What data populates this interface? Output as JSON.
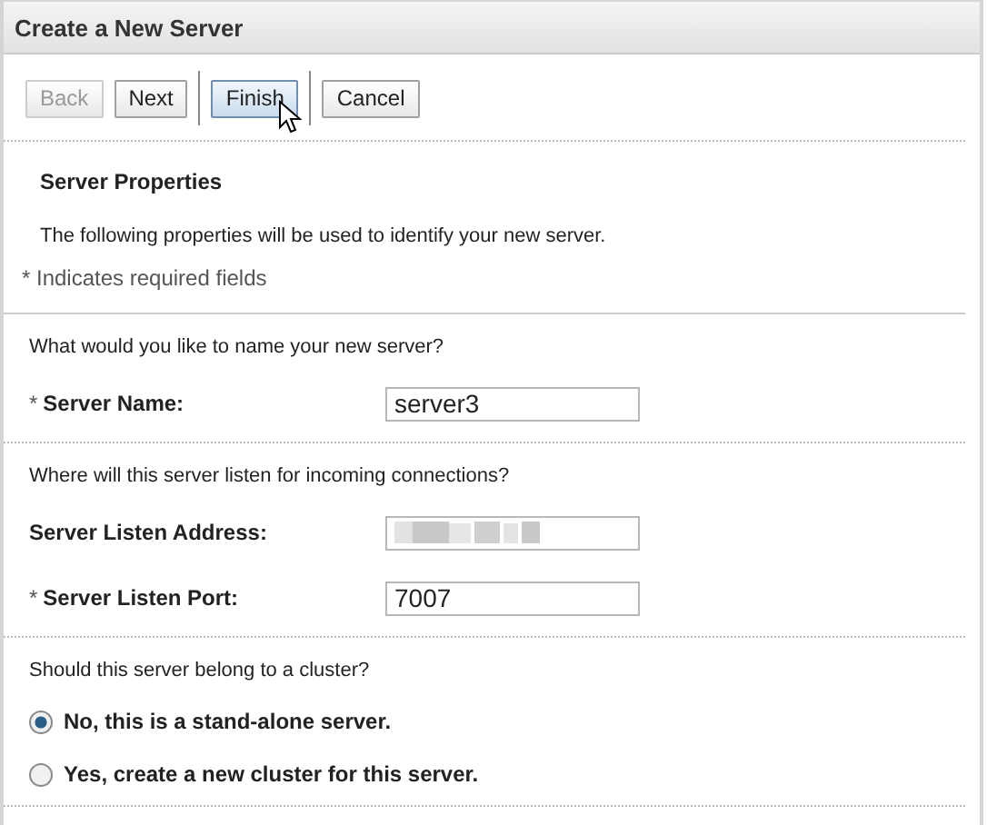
{
  "window": {
    "title": "Create a New Server"
  },
  "toolbar": [
    {
      "kind": "button",
      "label": "Back",
      "disabled": true,
      "hovered": false
    },
    {
      "kind": "button",
      "label": "Next",
      "disabled": false,
      "hovered": false
    },
    {
      "kind": "separator"
    },
    {
      "kind": "button",
      "label": "Finish",
      "disabled": false,
      "hovered": true
    },
    {
      "kind": "separator"
    },
    {
      "kind": "button",
      "label": "Cancel",
      "disabled": false,
      "hovered": false
    }
  ],
  "section": {
    "title": "Server Properties",
    "description": "The following properties will be used to identify your new server.",
    "required_note": "* Indicates required fields"
  },
  "groups": [
    {
      "question": "What would you like to name your new server?",
      "fields": [
        {
          "required_mark": "*",
          "label": "Server Name:",
          "value": "server3",
          "redacted": false
        }
      ]
    },
    {
      "question": "Where will this server listen for incoming connections?",
      "fields": [
        {
          "label": "Server Listen Address:",
          "redacted": true
        },
        {
          "required_mark": "*",
          "label": "Server Listen Port:",
          "value": "7007",
          "redacted": false
        }
      ]
    },
    {
      "question": "Should this server belong to a cluster?",
      "options": [
        {
          "label": "No, this is a stand-alone server.",
          "selected": true
        },
        {
          "label": "Yes, create a new cluster for this server.",
          "selected": false
        }
      ]
    }
  ]
}
